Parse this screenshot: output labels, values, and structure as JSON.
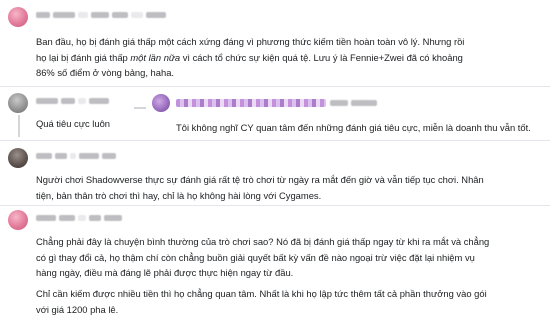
{
  "comments": [
    {
      "id": "c1",
      "text_lines": [
        "Ban đầu, họ bị đánh giá thấp một cách xứng đáng vì phương thức kiếm tiền hoàn toàn vô lý. Nhưng rồi",
        "họ lại bị đánh giá thấp",
        "một lần nữa",
        "vì cách tổ chức sự kiện quá tệ. Lưu ý là Fennie+Zwei đã có khoảng",
        "86% số điểm ở vòng bảng, haha."
      ]
    },
    {
      "id": "c2",
      "text": "Quá tiêu cực luôn"
    },
    {
      "id": "c2-reply",
      "text": "Tôi không nghĩ CY quan tâm đến những đánh giá tiêu cực, miễn là doanh thu vẫn tốt."
    },
    {
      "id": "c3",
      "text_lines": [
        "Người chơi Shadowverse thực sự đánh giá rất tệ trò chơi từ ngày ra mắt đến giờ và vẫn tiếp tục chơi. Nhân",
        "tiện, bản thân trò chơi thì hay, chỉ là họ không hài lòng với Cygames."
      ]
    },
    {
      "id": "c4",
      "text_lines": [
        "Chẳng phải đây là chuyện bình thường của trò chơi sao? Nó đã bị đánh giá thấp ngay từ khi ra mắt và chẳng",
        "có gì thay đổi cả, họ thậm chí còn chẳng buồn giải quyết bất kỳ vấn đề nào ngoại trừ việc đặt lại nhiệm vụ",
        "hàng ngày, điều mà đáng lẽ phải được thực hiện ngay từ đầu.",
        "Chỉ cần kiếm được nhiều tiền thì họ chẳng quan tâm. Nhất là khi họ lập tức thêm tất cả phần thưởng vào gói",
        "với giá 1200 pha lê."
      ]
    }
  ]
}
